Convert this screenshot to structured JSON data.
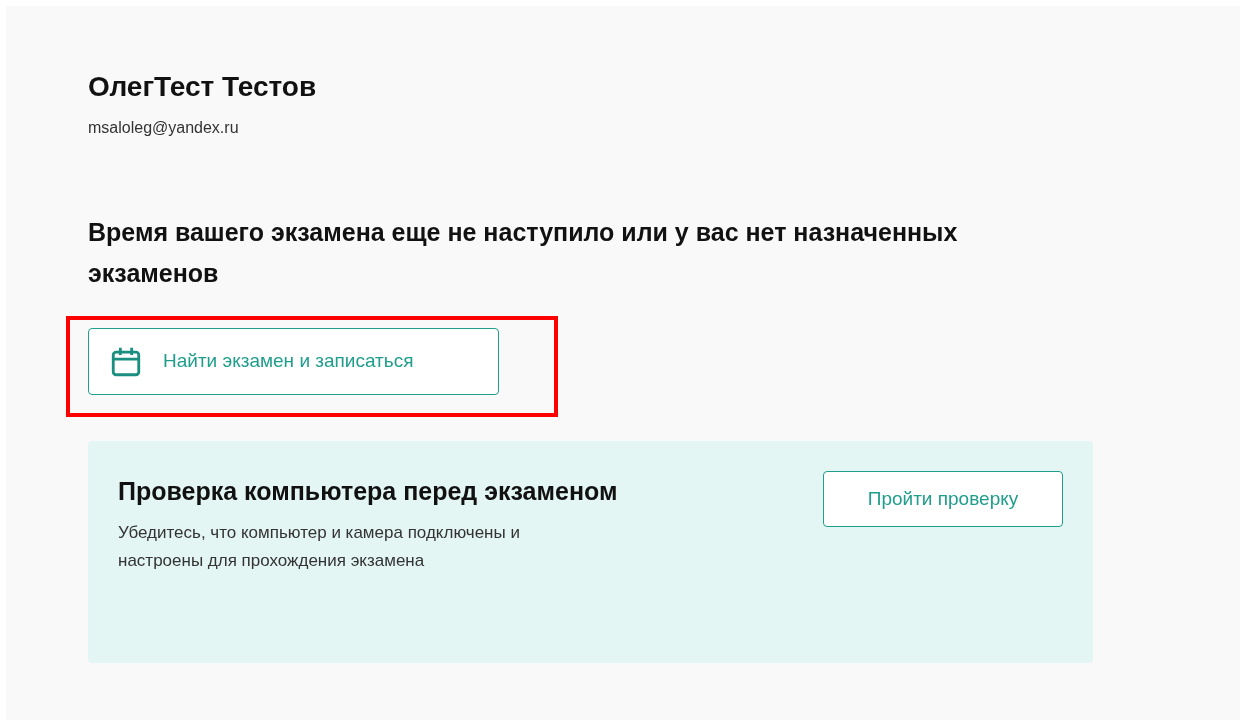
{
  "profile": {
    "name": "ОлегТест Тестов",
    "email": "msaloleg@yandex.ru"
  },
  "notice": {
    "heading": "Время вашего экзамена еще не наступило или у вас нет назначенных экзаменов"
  },
  "find_button": {
    "label": "Найти экзамен и записаться",
    "highlighted": true
  },
  "check_card": {
    "title": "Проверка компьютера перед экзаменом",
    "description": "Убедитесь, что компьютер и камера подключены и настроены для прохождения экзамена",
    "button": "Пройти проверку"
  }
}
